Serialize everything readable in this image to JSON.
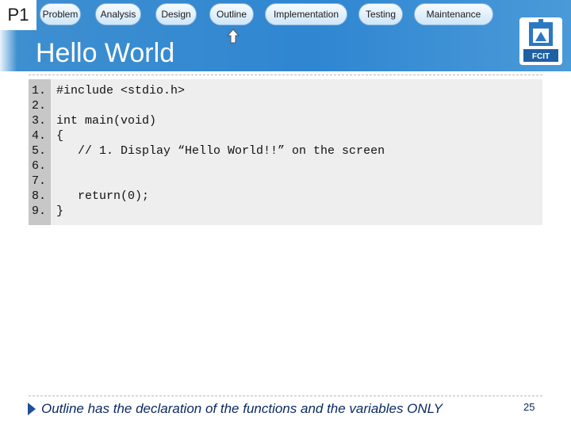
{
  "slide": {
    "section_marker": "P1",
    "title": "Hello World",
    "page_number": "25",
    "current_step": "Outline",
    "logo_text": "FCIT"
  },
  "nav": {
    "steps": [
      {
        "label": "Problem"
      },
      {
        "label": "Analysis"
      },
      {
        "label": "Design"
      },
      {
        "label": "Outline"
      },
      {
        "label": "Implementation"
      },
      {
        "label": "Testing"
      },
      {
        "label": "Maintenance"
      }
    ]
  },
  "code": {
    "lines": [
      {
        "no": "1.",
        "text": "#include <stdio.h>"
      },
      {
        "no": "2.",
        "text": ""
      },
      {
        "no": "3.",
        "text": "int main(void)"
      },
      {
        "no": "4.",
        "text": "{"
      },
      {
        "no": "5.",
        "text": "   // 1. Display “Hello World!!” on the screen"
      },
      {
        "no": "6.",
        "text": ""
      },
      {
        "no": "7.",
        "text": ""
      },
      {
        "no": "8.",
        "text": "   return(0);"
      },
      {
        "no": "9.",
        "text": "}"
      }
    ]
  },
  "footer": {
    "note": "Outline has the declaration of the functions and the variables ONLY"
  },
  "colors": {
    "header_blue": "#2f86d1",
    "pill_fill": "#cfe6f8",
    "code_background": "#eeeeee",
    "gutter": "#c7c7c7",
    "footer_text": "#0b2a63",
    "footer_arrow": "#1f4e9a"
  }
}
